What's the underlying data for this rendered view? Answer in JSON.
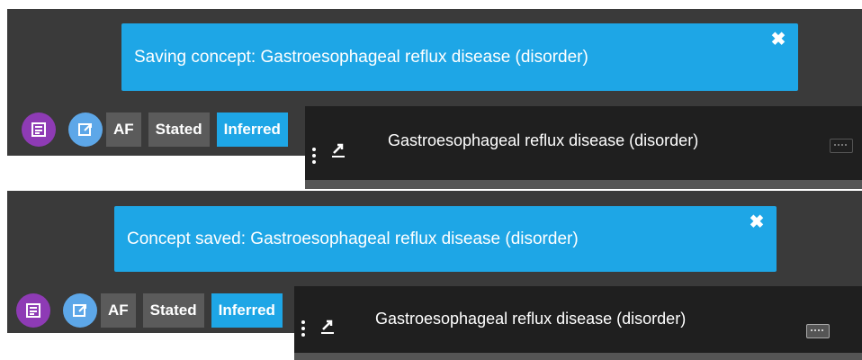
{
  "panels": [
    {
      "toast": {
        "message": "Saving concept: Gastroesophageal reflux disease (disorder)",
        "close_glyph": "✖"
      },
      "toolbar": {
        "af_label": "AF",
        "stated_label": "Stated",
        "inferred_label": "Inferred"
      },
      "concept": {
        "title": "Gastroesophageal reflux disease (disorder)"
      }
    },
    {
      "toast": {
        "message": "Concept saved: Gastroesophageal reflux disease (disorder)",
        "close_glyph": "✖"
      },
      "toolbar": {
        "af_label": "AF",
        "stated_label": "Stated",
        "inferred_label": "Inferred"
      },
      "concept": {
        "title": "Gastroesophageal reflux disease (disorder)"
      }
    }
  ],
  "colors": {
    "toast_bg": "#1ea6e6",
    "purple_btn": "#8e3bb5",
    "blue_btn": "#5da7e8",
    "dark_band": "#3a3a3a",
    "header_bg": "#1f1f1f"
  },
  "icons": [
    "close-icon",
    "newspaper-icon",
    "open-external-icon",
    "drag-handle-icon",
    "export-icon",
    "keyboard-icon"
  ]
}
